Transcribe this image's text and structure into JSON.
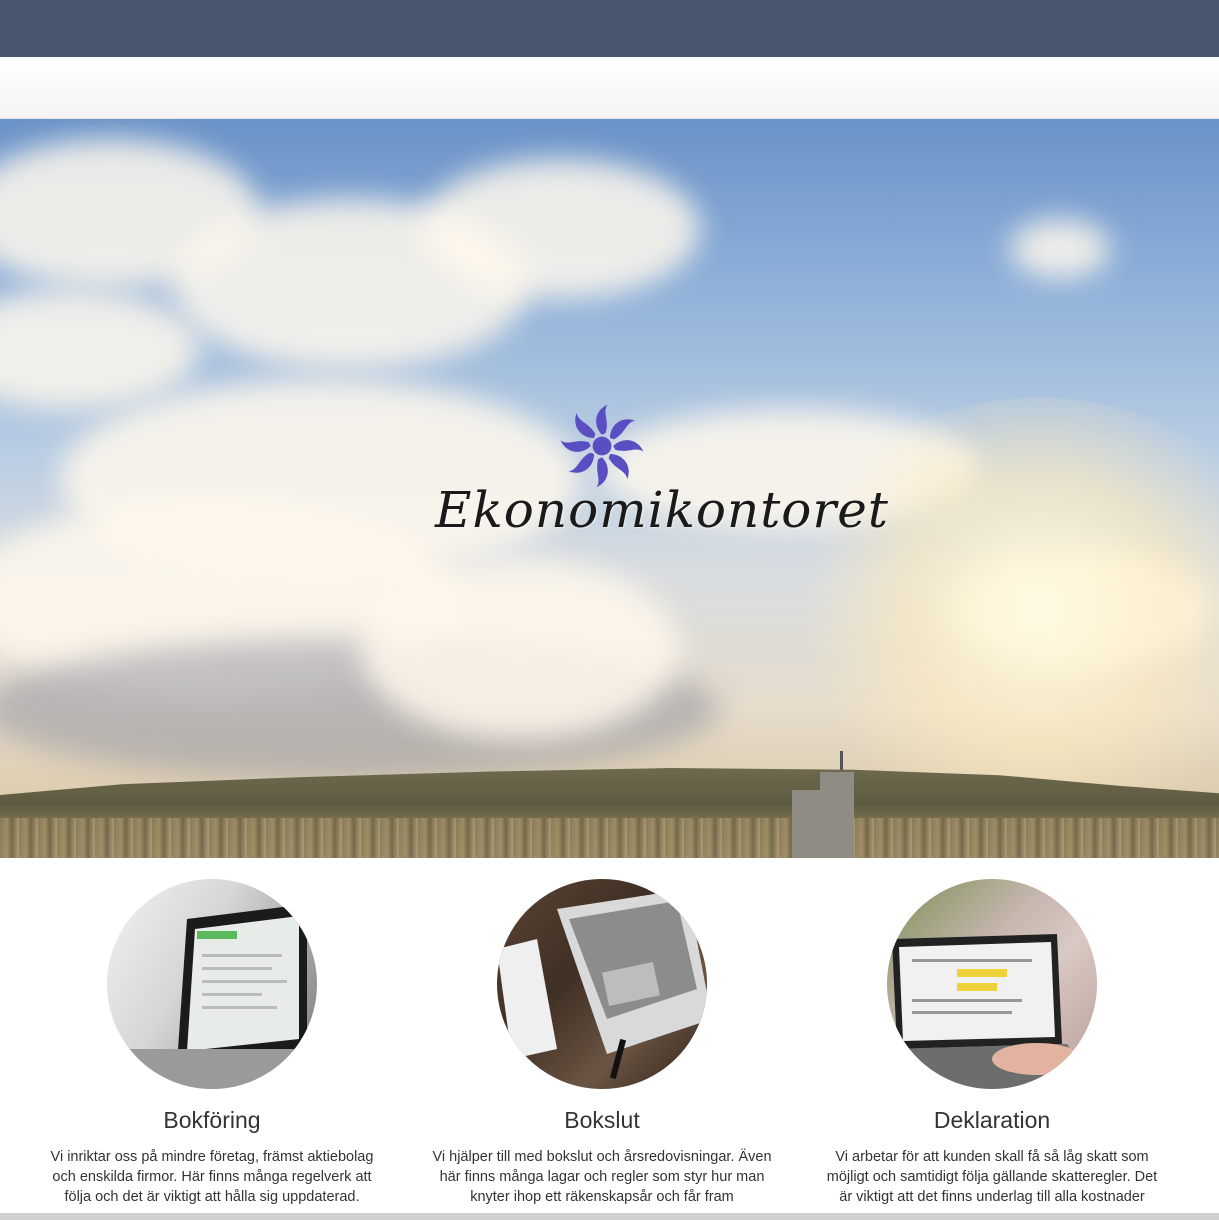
{
  "brand": {
    "name": "Ekonomikontoret",
    "colors": {
      "topbar": "#485670",
      "carousel_dot": "#e79f1e",
      "logo": "#5a4fc2"
    }
  },
  "hero": {
    "image": "sky-clouds-city-sunset",
    "carousel_dots": 3
  },
  "services": [
    {
      "title": "Bokföring",
      "image": "laptop-accounting-software",
      "text": "Vi inriktar oss på mindre företag, främst aktiebolag och enskilda firmor. Här finns många regelverk att följa och det är viktigt att hålla sig uppdaterad."
    },
    {
      "title": "Bokslut",
      "image": "laptop-on-wooden-desk",
      "text": "Vi hjälper till med bokslut och årsredovisningar. Även här finns många lagar och regler som styr hur man knyter ihop ett räkenskapsår och får fram"
    },
    {
      "title": "Deklaration",
      "image": "laptop-hands-typing",
      "text": "Vi arbetar för att kunden skall få så låg skatt som möjligt och samtidigt följa gällande skatteregler. Det är viktigt att det finns underlag till alla kostnader"
    }
  ]
}
